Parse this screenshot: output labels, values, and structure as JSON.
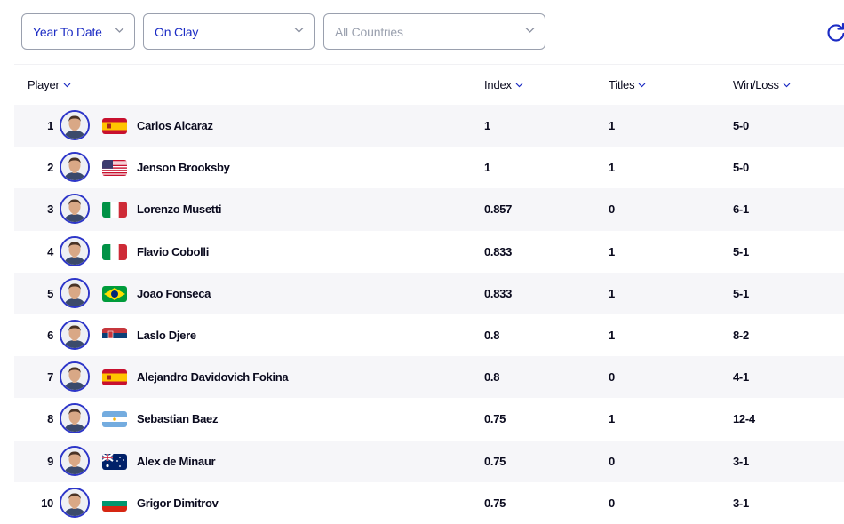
{
  "filters": {
    "period": "Year To Date",
    "surface": "On Clay",
    "country": "All Countries"
  },
  "columns": {
    "player": "Player",
    "index": "Index",
    "titles": "Titles",
    "win_loss": "Win/Loss"
  },
  "colors": {
    "accent": "#1c2cc4",
    "row_alt": "#f6f6f9",
    "avatar_ring": "#2d36c9"
  },
  "icons": {
    "refresh": "refresh-icon",
    "sort": "chevron-down-icon"
  },
  "players": [
    {
      "rank": "1",
      "name": "Carlos Alcaraz",
      "country": "spain",
      "index": "1",
      "titles": "1",
      "win_loss": "5-0"
    },
    {
      "rank": "2",
      "name": "Jenson Brooksby",
      "country": "usa",
      "index": "1",
      "titles": "1",
      "win_loss": "5-0"
    },
    {
      "rank": "3",
      "name": "Lorenzo Musetti",
      "country": "italy",
      "index": "0.857",
      "titles": "0",
      "win_loss": "6-1"
    },
    {
      "rank": "4",
      "name": "Flavio Cobolli",
      "country": "italy",
      "index": "0.833",
      "titles": "1",
      "win_loss": "5-1"
    },
    {
      "rank": "5",
      "name": "Joao Fonseca",
      "country": "brazil",
      "index": "0.833",
      "titles": "1",
      "win_loss": "5-1"
    },
    {
      "rank": "6",
      "name": "Laslo Djere",
      "country": "serbia",
      "index": "0.8",
      "titles": "1",
      "win_loss": "8-2"
    },
    {
      "rank": "7",
      "name": "Alejandro Davidovich Fokina",
      "country": "spain",
      "index": "0.8",
      "titles": "0",
      "win_loss": "4-1"
    },
    {
      "rank": "8",
      "name": "Sebastian Baez",
      "country": "argentina",
      "index": "0.75",
      "titles": "1",
      "win_loss": "12-4"
    },
    {
      "rank": "9",
      "name": "Alex de Minaur",
      "country": "australia",
      "index": "0.75",
      "titles": "0",
      "win_loss": "3-1"
    },
    {
      "rank": "10",
      "name": "Grigor Dimitrov",
      "country": "bulgaria",
      "index": "0.75",
      "titles": "0",
      "win_loss": "3-1"
    }
  ]
}
